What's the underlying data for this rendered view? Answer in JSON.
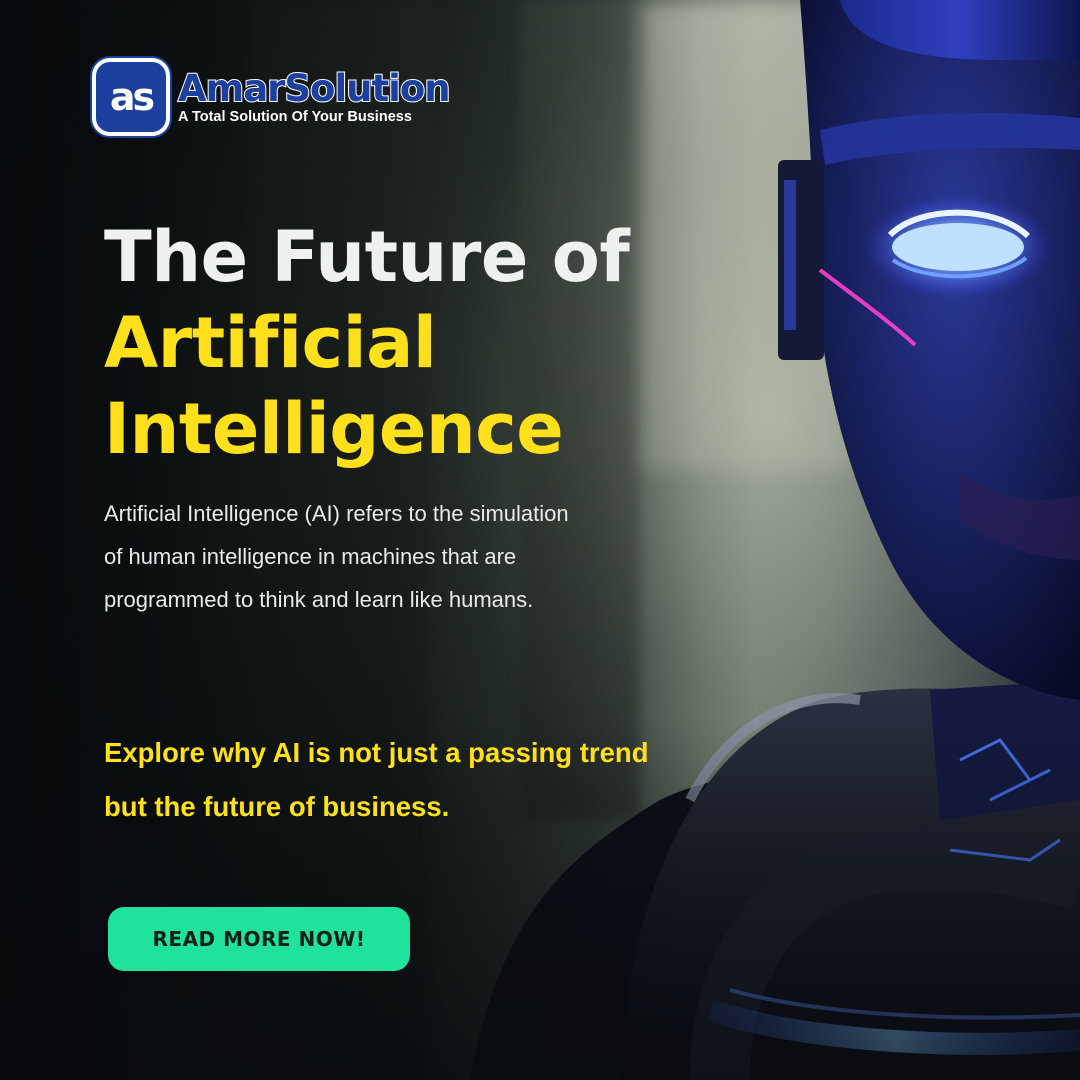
{
  "brand": {
    "badge_text": "as",
    "name": "AmarSolution",
    "tagline": "A Total Solution Of Your Business",
    "color": "#1d3f9e"
  },
  "headline": {
    "line1": "The Future of",
    "line2": "Artificial",
    "line3": "Intelligence",
    "accent_color": "#ffe01b"
  },
  "description": "Artificial Intelligence (AI) refers to the simulation of human intelligence in machines that are programmed to think and learn like humans.",
  "call_to_action": "Explore why AI is not just a passing trend but the future of business.",
  "button": {
    "label": "READ MORE NOW!",
    "color": "#1fe39c"
  },
  "image": {
    "subject": "robot-head-icon"
  }
}
